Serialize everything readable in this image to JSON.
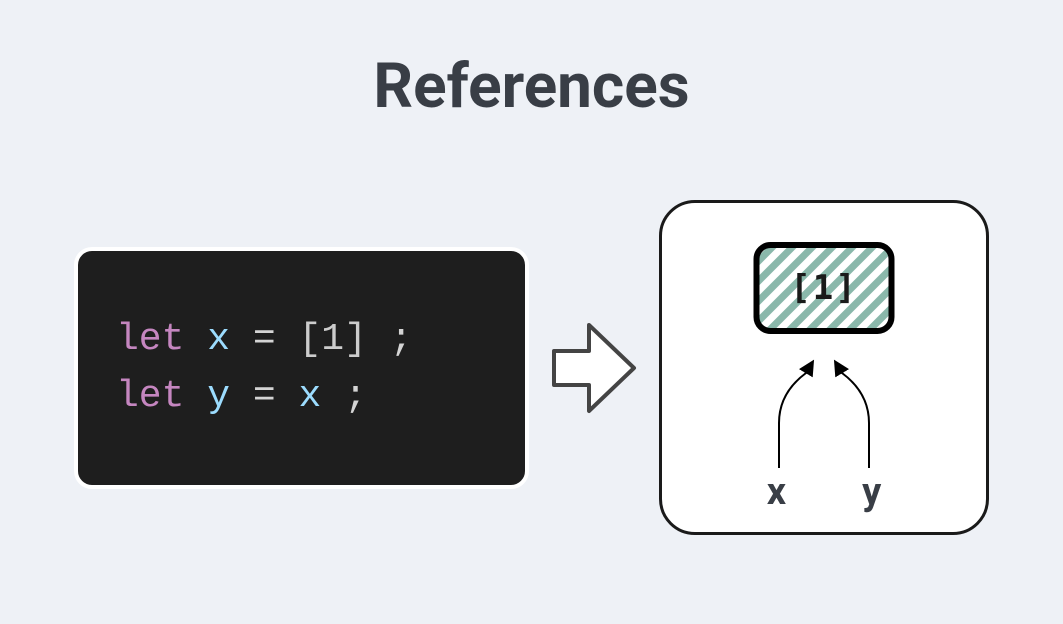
{
  "title": "References",
  "code": {
    "line1": {
      "kw": "let",
      "var": "x",
      "op": "=",
      "val": "[1]",
      "end": ";"
    },
    "line2": {
      "kw": "let",
      "var": "y",
      "op": "=",
      "rhs": "x",
      "end": ";"
    }
  },
  "diagram": {
    "heapValue": "[1]",
    "pointerA": "x",
    "pointerB": "y"
  }
}
